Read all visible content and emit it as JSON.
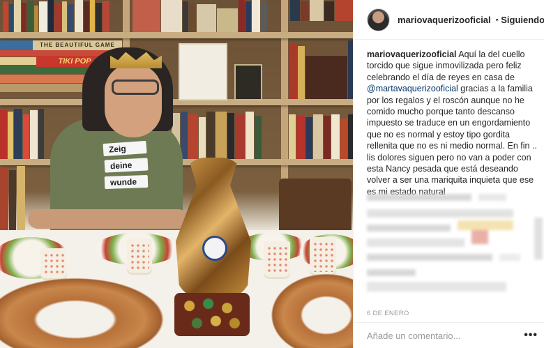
{
  "post": {
    "username": "mariovaquerizooficial",
    "separator": "•",
    "follow_status": "Siguiendo",
    "caption": {
      "author": "mariovaquerizooficial",
      "text_before_mention": " Aquí la del cuello torcido que sigue inmovilizada pero feliz celebrando el día de reyes en casa de ",
      "mention": "@martavaquerizooficial",
      "text_after_mention": " gracias a la familia por los regalos y el roscón aunque no he comido mucho porque tanto descanso impuesto se traduce en un engordamiento que no es normal y estoy tipo gordita rellenita que no es ni medio normal. En fin .. lis dolores siguen pero no van a poder con esta Nancy pesada que está deseando volver a ser una mariquita inquieta que ese es mi estado natural"
    },
    "date": "6 DE ENERO",
    "comment_placeholder": "Añade un comentario...",
    "more_label": "•••"
  },
  "photo": {
    "book_titles": [
      "THE BEAUTIFUL GAME",
      "TIKI POP"
    ],
    "shirt_words": [
      "Zeig",
      "deine",
      "wunde"
    ]
  },
  "colors": {
    "verified_badge": "#3897f0",
    "mention": "#003569",
    "muted": "#999999",
    "border": "#efefef"
  },
  "icons": {
    "verified": "verified-badge-icon",
    "more": "more-options-icon"
  }
}
